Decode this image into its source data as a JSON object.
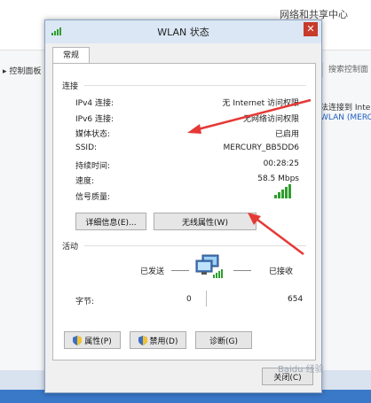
{
  "background": {
    "title": "网络和共享中心",
    "nav": "控制面板",
    "search": "搜索控制面",
    "right_text_1": "法连接到 Inte",
    "right_text_2": "WLAN (MERCU"
  },
  "dialog": {
    "title": "WLAN 状态",
    "close_glyph": "✕",
    "tab": "常规",
    "connection_label": "连接",
    "rows": [
      {
        "label": "IPv4 连接:",
        "value": "无 Internet 访问权限"
      },
      {
        "label": "IPv6 连接:",
        "value": "无网络访问权限"
      },
      {
        "label": "媒体状态:",
        "value": "已启用"
      },
      {
        "label": "SSID:",
        "value": "MERCURY_BB5DD6"
      },
      {
        "label": "持续时间:",
        "value": "00:28:25"
      },
      {
        "label": "速度:",
        "value": "58.5 Mbps"
      },
      {
        "label": "信号质量:",
        "value": ""
      }
    ],
    "details_button": "详细信息(E)...",
    "wireless_props_button": "无线属性(W)",
    "activity_label": "活动",
    "sent_label": "已发送",
    "received_label": "已接收",
    "bytes_label": "字节:",
    "bytes_sent": "0",
    "bytes_received": "654",
    "properties_button": "属性(P)",
    "disable_button": "禁用(D)",
    "diagnose_button": "诊断(G)",
    "close_button": "关闭(C)"
  },
  "watermark": "Baidu 经验",
  "colors": {
    "arrow": "#e53935",
    "signal": "#2e9e2e",
    "title_bar": "#dbe7f5",
    "close": "#c73a2c"
  },
  "signal_bars": 5
}
